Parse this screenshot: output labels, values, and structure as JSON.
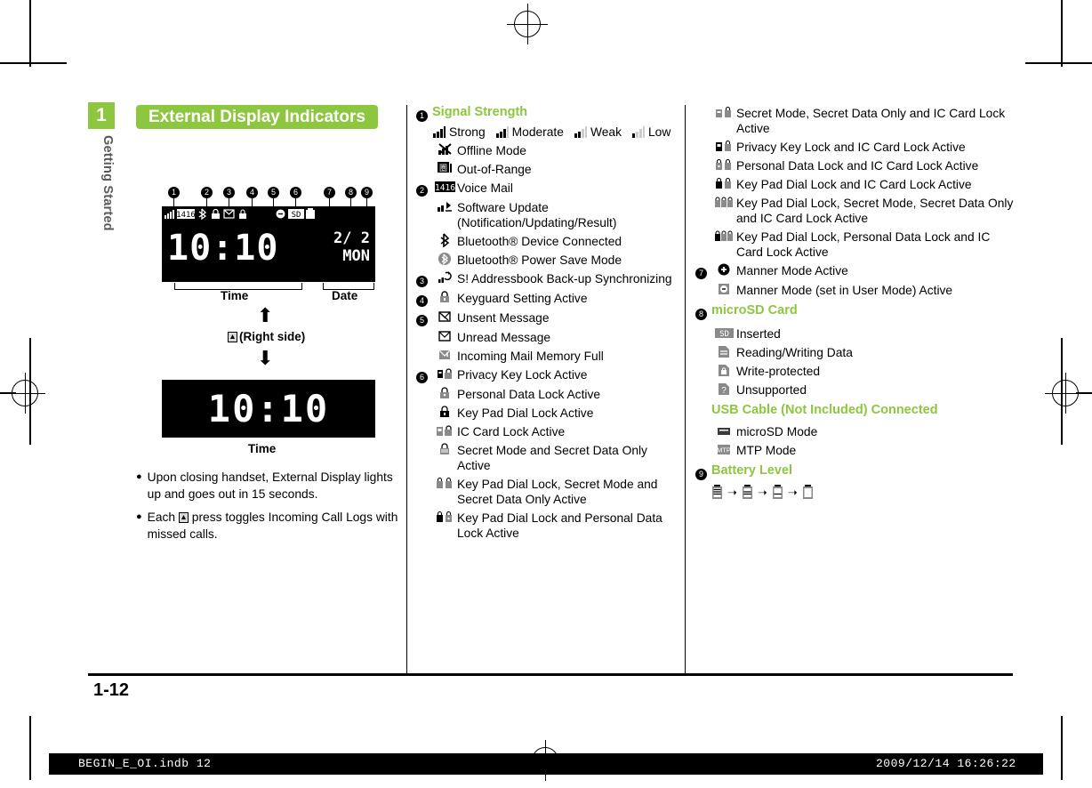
{
  "chapter": {
    "number": "1",
    "label": "Getting Started"
  },
  "page": {
    "number": "1-12"
  },
  "footer": {
    "left": "BEGIN_E_OI.indb   12",
    "right": "2009/12/14   16:26:22"
  },
  "title": "External Display Indicators",
  "figure": {
    "lcd_main": {
      "time": "10:10",
      "date_line1": "2/  2",
      "date_line2": "MON",
      "status_code": "1416"
    },
    "lcd_alt": {
      "time": "10:10"
    },
    "label_time": "Time",
    "label_date": "Date",
    "label_time2": "Time",
    "right_side": "(Right side)",
    "callouts": [
      "1",
      "2",
      "3",
      "4",
      "5",
      "6",
      "7",
      "8",
      "9"
    ]
  },
  "bullets": [
    "Upon closing handset, External Display lights up and goes out in 15 seconds.",
    "Each    press toggles Incoming Call Logs with missed calls."
  ],
  "columns": {
    "middle": [
      {
        "num": "1",
        "category": "Signal Strength"
      },
      {
        "type": "signal-row",
        "items": [
          {
            "label": "Strong",
            "icon": "signal-4"
          },
          {
            "label": "Moderate",
            "icon": "signal-3"
          },
          {
            "label": "Weak",
            "icon": "signal-2"
          },
          {
            "label": "Low",
            "icon": "signal-1"
          }
        ]
      },
      {
        "icon": "offline-mode",
        "label": "Offline Mode"
      },
      {
        "icon": "out-of-range",
        "label": "Out-of-Range"
      },
      {
        "num": "2",
        "icon": "voice-mail",
        "label": "Voice Mail"
      },
      {
        "icon": "software-update",
        "label": "Software Update (Notification/Updating/Result)"
      },
      {
        "icon": "bluetooth",
        "label": "Bluetooth® Device Connected"
      },
      {
        "icon": "bluetooth-power-save",
        "label": "Bluetooth® Power Save Mode"
      },
      {
        "num": "3",
        "icon": "addressbook-sync",
        "label": "S! Addressbook Back-up Synchronizing"
      },
      {
        "num": "4",
        "icon": "keyguard",
        "label": "Keyguard Setting Active"
      },
      {
        "num": "5",
        "icon": "unsent-message",
        "label": "Unsent Message"
      },
      {
        "icon": "unread-message",
        "label": "Unread Message"
      },
      {
        "icon": "mail-memory-full",
        "label": "Incoming Mail Memory Full"
      },
      {
        "num": "6",
        "icon": "privacy-key-lock",
        "label": "Privacy Key Lock Active"
      },
      {
        "icon": "personal-data-lock",
        "label": "Personal Data Lock Active"
      },
      {
        "icon": "key-pad-dial-lock",
        "label": "Key Pad Dial Lock Active"
      },
      {
        "icon": "ic-card-lock",
        "label": "IC Card Lock Active"
      },
      {
        "icon": "secret-mode",
        "label": "Secret Mode and Secret Data Only Active"
      },
      {
        "icon": "keypad-secret",
        "label": "Key Pad Dial Lock, Secret Mode and Secret Data Only Active"
      },
      {
        "icon": "keypad-personal",
        "label": "Key Pad Dial Lock and Personal Data Lock Active"
      }
    ],
    "right": [
      {
        "icon": "secret-ic",
        "label": "Secret Mode, Secret Data Only and IC Card Lock Active"
      },
      {
        "icon": "privacy-ic",
        "label": "Privacy Key Lock and IC Card Lock Active"
      },
      {
        "icon": "personal-ic",
        "label": "Personal Data Lock and IC Card Lock Active"
      },
      {
        "icon": "keypad-ic",
        "label": "Key Pad Dial Lock and IC Card Lock Active"
      },
      {
        "icon": "keypad-secret-ic",
        "label": "Key Pad Dial Lock, Secret Mode, Secret Data Only and IC Card Lock Active"
      },
      {
        "icon": "keypad-personal-ic",
        "label": "Key Pad Dial Lock, Personal Data Lock and IC Card Lock Active"
      },
      {
        "num": "7",
        "icon": "manner-mode",
        "label": "Manner Mode Active"
      },
      {
        "icon": "manner-user",
        "label": "Manner Mode (set in User Mode) Active"
      },
      {
        "num": "8",
        "category": "microSD Card"
      },
      {
        "icon": "sd-inserted",
        "label": "Inserted"
      },
      {
        "icon": "sd-rw",
        "label": "Reading/Writing Data"
      },
      {
        "icon": "sd-protected",
        "label": "Write-protected"
      },
      {
        "icon": "sd-unsupported",
        "label": "Unsupported"
      },
      {
        "category": "USB Cable (Not Included) Connected"
      },
      {
        "icon": "usb-microsd",
        "label": "microSD Mode"
      },
      {
        "icon": "usb-mtp",
        "label": "MTP Mode"
      },
      {
        "num": "9",
        "category": "Battery Level"
      },
      {
        "type": "battery-seq",
        "icons": [
          "battery-full",
          "battery-3",
          "battery-2",
          "battery-1"
        ],
        "sep": "➝"
      }
    ]
  },
  "colors": {
    "accent": "#8dc63f",
    "text": "#000000",
    "footer_bar": "#000000"
  }
}
